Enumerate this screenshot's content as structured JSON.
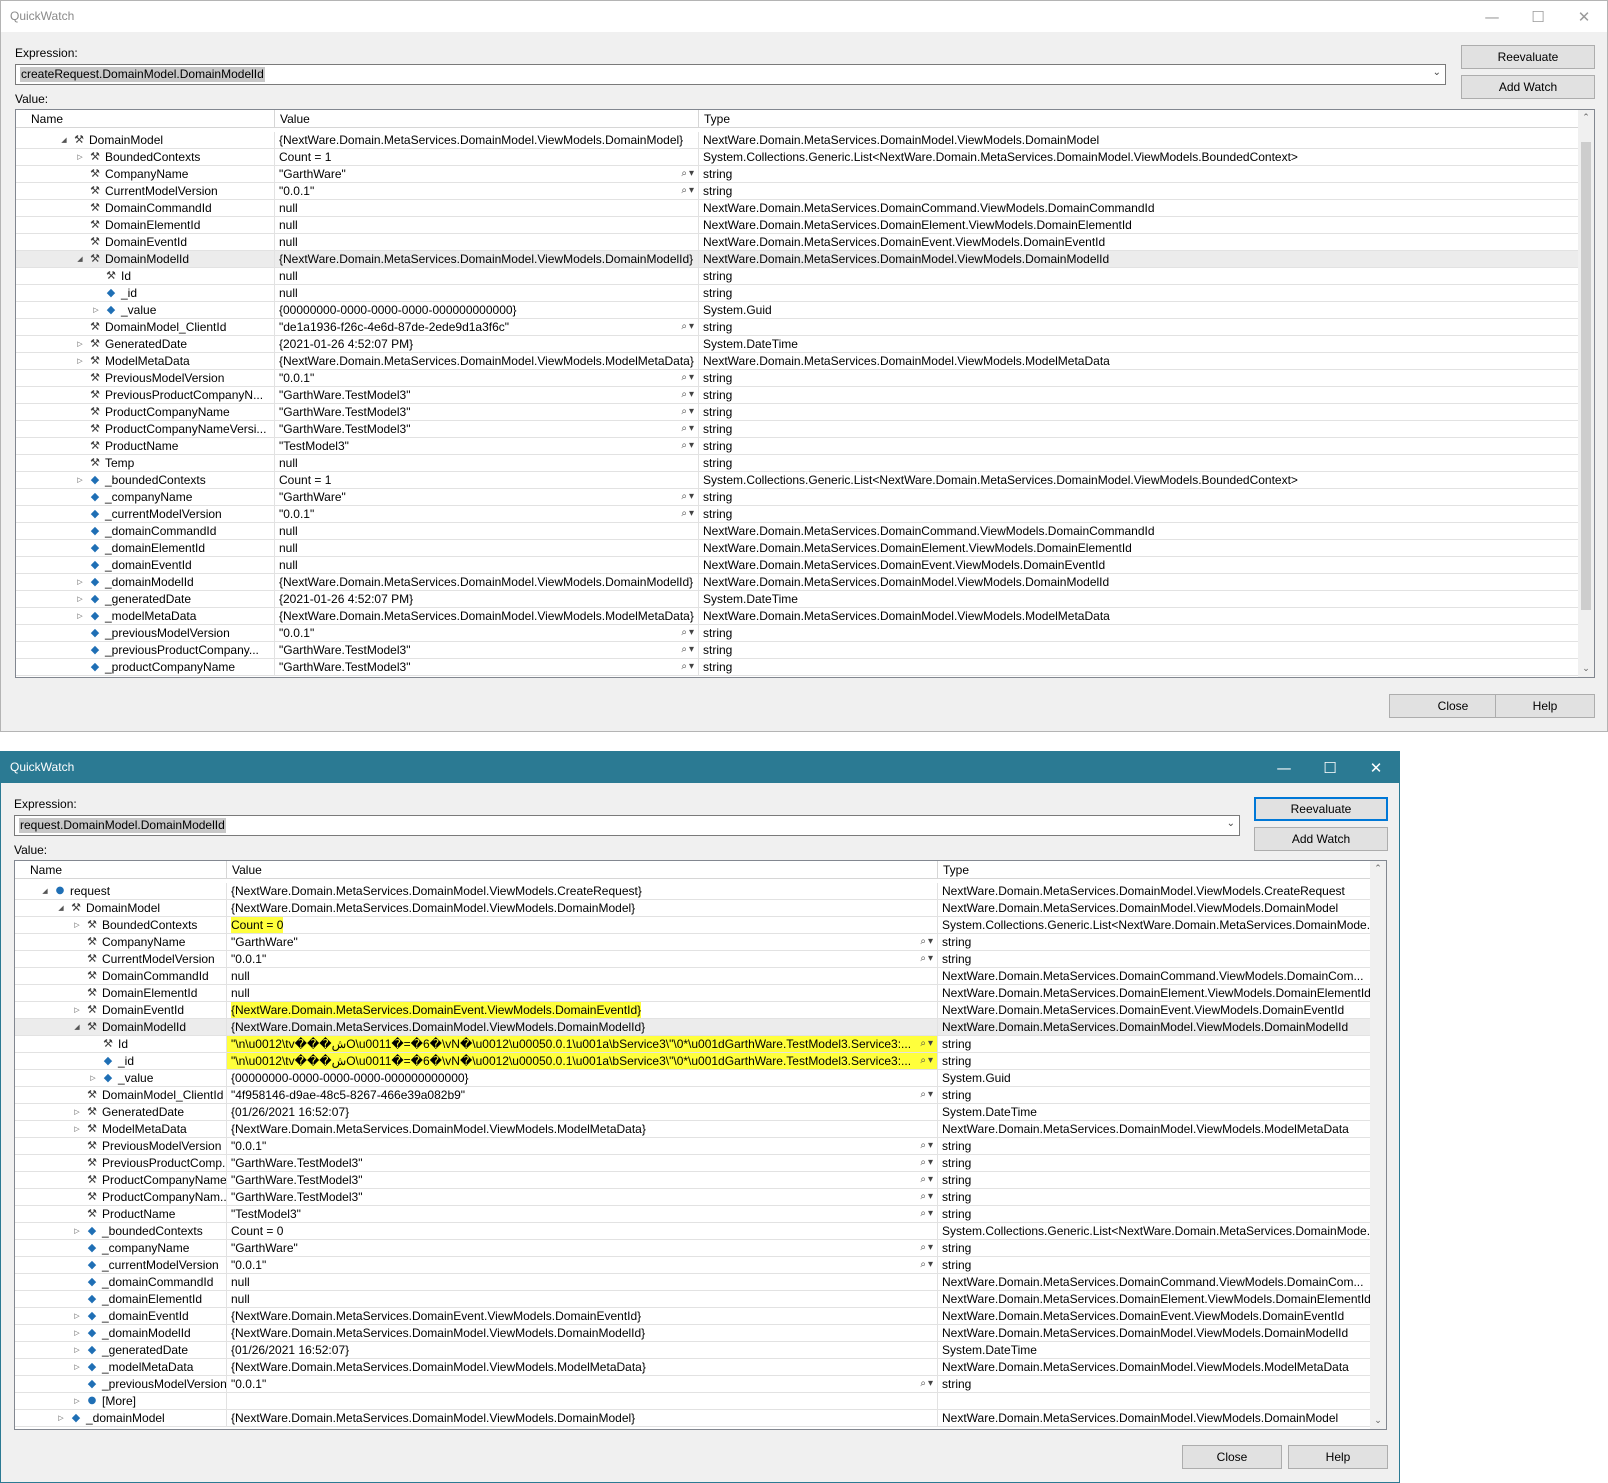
{
  "window1": {
    "title": "QuickWatch",
    "expression_label": "Expression:",
    "expression": "createRequest.DomainModel.DomainModelId",
    "value_label": "Value:",
    "buttons": {
      "reevaluate": "Reevaluate",
      "add_watch": "Add Watch",
      "close": "Close",
      "help": "Help"
    },
    "columns": [
      "Name",
      "Value",
      "Type"
    ],
    "rows": [
      {
        "depth": 1,
        "exp": "open",
        "icon": "prop",
        "name": "DomainModel",
        "value": "{NextWare.Domain.MetaServices.DomainModel.ViewModels.DomainModel}",
        "type": "NextWare.Domain.MetaServices.DomainModel.ViewModels.DomainModel"
      },
      {
        "depth": 2,
        "exp": "closed",
        "icon": "prop",
        "name": "BoundedContexts",
        "value": "Count = 1",
        "type": "System.Collections.Generic.List<NextWare.Domain.MetaServices.DomainModel.ViewModels.BoundedContext>"
      },
      {
        "depth": 2,
        "icon": "prop",
        "name": "CompanyName",
        "value": "\"GarthWare\"",
        "tools": true,
        "type": "string"
      },
      {
        "depth": 2,
        "icon": "prop",
        "name": "CurrentModelVersion",
        "value": "\"0.0.1\"",
        "tools": true,
        "type": "string"
      },
      {
        "depth": 2,
        "icon": "prop",
        "name": "DomainCommandId",
        "value": "null",
        "type": "NextWare.Domain.MetaServices.DomainCommand.ViewModels.DomainCommandId"
      },
      {
        "depth": 2,
        "icon": "prop",
        "name": "DomainElementId",
        "value": "null",
        "type": "NextWare.Domain.MetaServices.DomainElement.ViewModels.DomainElementId"
      },
      {
        "depth": 2,
        "icon": "prop",
        "name": "DomainEventId",
        "value": "null",
        "type": "NextWare.Domain.MetaServices.DomainEvent.ViewModels.DomainEventId"
      },
      {
        "depth": 2,
        "exp": "open",
        "icon": "prop",
        "name": "DomainModelId",
        "value": "{NextWare.Domain.MetaServices.DomainModel.ViewModels.DomainModelId}",
        "type": "NextWare.Domain.MetaServices.DomainModel.ViewModels.DomainModelId",
        "selected": true
      },
      {
        "depth": 3,
        "icon": "prop",
        "name": "Id",
        "value": "null",
        "type": "string"
      },
      {
        "depth": 3,
        "icon": "field",
        "name": "_id",
        "value": "null",
        "type": "string"
      },
      {
        "depth": 3,
        "exp": "closed",
        "icon": "field",
        "name": "_value",
        "value": "{00000000-0000-0000-0000-000000000000}",
        "type": "System.Guid"
      },
      {
        "depth": 2,
        "icon": "prop",
        "name": "DomainModel_ClientId",
        "value": "\"de1a1936-f26c-4e6d-87de-2ede9d1a3f6c\"",
        "tools": true,
        "type": "string"
      },
      {
        "depth": 2,
        "exp": "closed",
        "icon": "prop",
        "name": "GeneratedDate",
        "value": "{2021-01-26 4:52:07 PM}",
        "type": "System.DateTime"
      },
      {
        "depth": 2,
        "exp": "closed",
        "icon": "prop",
        "name": "ModelMetaData",
        "value": "{NextWare.Domain.MetaServices.DomainModel.ViewModels.ModelMetaData}",
        "type": "NextWare.Domain.MetaServices.DomainModel.ViewModels.ModelMetaData"
      },
      {
        "depth": 2,
        "icon": "prop",
        "name": "PreviousModelVersion",
        "value": "\"0.0.1\"",
        "tools": true,
        "type": "string"
      },
      {
        "depth": 2,
        "icon": "prop",
        "name": "PreviousProductCompanyN...",
        "value": "\"GarthWare.TestModel3\"",
        "tools": true,
        "type": "string"
      },
      {
        "depth": 2,
        "icon": "prop",
        "name": "ProductCompanyName",
        "value": "\"GarthWare.TestModel3\"",
        "tools": true,
        "type": "string"
      },
      {
        "depth": 2,
        "icon": "prop",
        "name": "ProductCompanyNameVersi...",
        "value": "\"GarthWare.TestModel3\"",
        "tools": true,
        "type": "string"
      },
      {
        "depth": 2,
        "icon": "prop",
        "name": "ProductName",
        "value": "\"TestModel3\"",
        "tools": true,
        "type": "string"
      },
      {
        "depth": 2,
        "icon": "prop",
        "name": "Temp",
        "value": "null",
        "type": "string"
      },
      {
        "depth": 2,
        "exp": "closed",
        "icon": "field",
        "name": "_boundedContexts",
        "value": "Count = 1",
        "type": "System.Collections.Generic.List<NextWare.Domain.MetaServices.DomainModel.ViewModels.BoundedContext>"
      },
      {
        "depth": 2,
        "icon": "field",
        "name": "_companyName",
        "value": "\"GarthWare\"",
        "tools": true,
        "type": "string"
      },
      {
        "depth": 2,
        "icon": "field",
        "name": "_currentModelVersion",
        "value": "\"0.0.1\"",
        "tools": true,
        "type": "string"
      },
      {
        "depth": 2,
        "icon": "field",
        "name": "_domainCommandId",
        "value": "null",
        "type": "NextWare.Domain.MetaServices.DomainCommand.ViewModels.DomainCommandId"
      },
      {
        "depth": 2,
        "icon": "field",
        "name": "_domainElementId",
        "value": "null",
        "type": "NextWare.Domain.MetaServices.DomainElement.ViewModels.DomainElementId"
      },
      {
        "depth": 2,
        "icon": "field",
        "name": "_domainEventId",
        "value": "null",
        "type": "NextWare.Domain.MetaServices.DomainEvent.ViewModels.DomainEventId"
      },
      {
        "depth": 2,
        "exp": "closed",
        "icon": "field",
        "name": "_domainModelId",
        "value": "{NextWare.Domain.MetaServices.DomainModel.ViewModels.DomainModelId}",
        "type": "NextWare.Domain.MetaServices.DomainModel.ViewModels.DomainModelId"
      },
      {
        "depth": 2,
        "exp": "closed",
        "icon": "field",
        "name": "_generatedDate",
        "value": "{2021-01-26 4:52:07 PM}",
        "type": "System.DateTime"
      },
      {
        "depth": 2,
        "exp": "closed",
        "icon": "field",
        "name": "_modelMetaData",
        "value": "{NextWare.Domain.MetaServices.DomainModel.ViewModels.ModelMetaData}",
        "type": "NextWare.Domain.MetaServices.DomainModel.ViewModels.ModelMetaData"
      },
      {
        "depth": 2,
        "icon": "field",
        "name": "_previousModelVersion",
        "value": "\"0.0.1\"",
        "tools": true,
        "type": "string"
      },
      {
        "depth": 2,
        "icon": "field",
        "name": "_previousProductCompany...",
        "value": "\"GarthWare.TestModel3\"",
        "tools": true,
        "type": "string"
      },
      {
        "depth": 2,
        "icon": "field",
        "name": "_productCompanyName",
        "value": "\"GarthWare.TestModel3\"",
        "tools": true,
        "type": "string"
      }
    ]
  },
  "window2": {
    "title": "QuickWatch",
    "expression_label": "Expression:",
    "expression": "request.DomainModel.DomainModelId",
    "value_label": "Value:",
    "buttons": {
      "reevaluate": "Reevaluate",
      "add_watch": "Add Watch",
      "close": "Close",
      "help": "Help"
    },
    "columns": [
      "Name",
      "Value",
      "Type"
    ],
    "rows": [
      {
        "depth": 0,
        "exp": "open",
        "icon": "obj",
        "name": "request",
        "value": "{NextWare.Domain.MetaServices.DomainModel.ViewModels.CreateRequest}",
        "type": "NextWare.Domain.MetaServices.DomainModel.ViewModels.CreateRequest"
      },
      {
        "depth": 1,
        "exp": "open",
        "icon": "prop",
        "name": "DomainModel",
        "value": "{NextWare.Domain.MetaServices.DomainModel.ViewModels.DomainModel}",
        "type": "NextWare.Domain.MetaServices.DomainModel.ViewModels.DomainModel"
      },
      {
        "depth": 2,
        "exp": "closed",
        "icon": "prop",
        "name": "BoundedContexts",
        "value": "Count = 0",
        "highlight": true,
        "type": "System.Collections.Generic.List<NextWare.Domain.MetaServices.DomainMode..."
      },
      {
        "depth": 2,
        "icon": "prop",
        "name": "CompanyName",
        "value": "\"GarthWare\"",
        "tools": true,
        "type": "string"
      },
      {
        "depth": 2,
        "icon": "prop",
        "name": "CurrentModelVersion",
        "value": "\"0.0.1\"",
        "tools": true,
        "type": "string"
      },
      {
        "depth": 2,
        "icon": "prop",
        "name": "DomainCommandId",
        "value": "null",
        "type": "NextWare.Domain.MetaServices.DomainCommand.ViewModels.DomainCom..."
      },
      {
        "depth": 2,
        "icon": "prop",
        "name": "DomainElementId",
        "value": "null",
        "type": "NextWare.Domain.MetaServices.DomainElement.ViewModels.DomainElementId"
      },
      {
        "depth": 2,
        "exp": "closed",
        "icon": "prop",
        "name": "DomainEventId",
        "value": "{NextWare.Domain.MetaServices.DomainEvent.ViewModels.DomainEventId}",
        "highlight": true,
        "type": "NextWare.Domain.MetaServices.DomainEvent.ViewModels.DomainEventId"
      },
      {
        "depth": 2,
        "exp": "open",
        "icon": "prop",
        "name": "DomainModelId",
        "value": "{NextWare.Domain.MetaServices.DomainModel.ViewModels.DomainModelId}",
        "type": "NextWare.Domain.MetaServices.DomainModel.ViewModels.DomainModelId",
        "selected": true
      },
      {
        "depth": 3,
        "icon": "prop",
        "name": "Id",
        "value": "\"\\n\\u0012\\tv���شO\\u0011�=�6�\\vN�\\u0012\\u00050.0.1\\u001a\\bService3\\\"\\0*\\u001dGarthWare.TestModel3.Service3:...",
        "highlight": true,
        "tools": true,
        "type": "string"
      },
      {
        "depth": 3,
        "icon": "field",
        "name": "_id",
        "value": "\"\\n\\u0012\\tv���شO\\u0011�=�6�\\vN�\\u0012\\u00050.0.1\\u001a\\bService3\\\"\\0*\\u001dGarthWare.TestModel3.Service3:...",
        "highlight": true,
        "tools": true,
        "type": "string"
      },
      {
        "depth": 3,
        "exp": "closed",
        "icon": "field",
        "name": "_value",
        "value": "{00000000-0000-0000-0000-000000000000}",
        "type": "System.Guid"
      },
      {
        "depth": 2,
        "icon": "prop",
        "name": "DomainModel_ClientId",
        "value": "\"4f958146-d9ae-48c5-8267-466e39a082b9\"",
        "tools": true,
        "type": "string"
      },
      {
        "depth": 2,
        "exp": "closed",
        "icon": "prop",
        "name": "GeneratedDate",
        "value": "{01/26/2021 16:52:07}",
        "type": "System.DateTime"
      },
      {
        "depth": 2,
        "exp": "closed",
        "icon": "prop",
        "name": "ModelMetaData",
        "value": "{NextWare.Domain.MetaServices.DomainModel.ViewModels.ModelMetaData}",
        "type": "NextWare.Domain.MetaServices.DomainModel.ViewModels.ModelMetaData"
      },
      {
        "depth": 2,
        "icon": "prop",
        "name": "PreviousModelVersion",
        "value": "\"0.0.1\"",
        "tools": true,
        "type": "string"
      },
      {
        "depth": 2,
        "icon": "prop",
        "name": "PreviousProductComp...",
        "value": "\"GarthWare.TestModel3\"",
        "tools": true,
        "type": "string"
      },
      {
        "depth": 2,
        "icon": "prop",
        "name": "ProductCompanyName",
        "value": "\"GarthWare.TestModel3\"",
        "tools": true,
        "type": "string"
      },
      {
        "depth": 2,
        "icon": "prop",
        "name": "ProductCompanyNam...",
        "value": "\"GarthWare.TestModel3\"",
        "tools": true,
        "type": "string"
      },
      {
        "depth": 2,
        "icon": "prop",
        "name": "ProductName",
        "value": "\"TestModel3\"",
        "tools": true,
        "type": "string"
      },
      {
        "depth": 2,
        "exp": "closed",
        "icon": "field",
        "name": "_boundedContexts",
        "value": "Count = 0",
        "type": "System.Collections.Generic.List<NextWare.Domain.MetaServices.DomainMode..."
      },
      {
        "depth": 2,
        "icon": "field",
        "name": "_companyName",
        "value": "\"GarthWare\"",
        "tools": true,
        "type": "string"
      },
      {
        "depth": 2,
        "icon": "field",
        "name": "_currentModelVersion",
        "value": "\"0.0.1\"",
        "tools": true,
        "type": "string"
      },
      {
        "depth": 2,
        "icon": "field",
        "name": "_domainCommandId",
        "value": "null",
        "type": "NextWare.Domain.MetaServices.DomainCommand.ViewModels.DomainCom..."
      },
      {
        "depth": 2,
        "icon": "field",
        "name": "_domainElementId",
        "value": "null",
        "type": "NextWare.Domain.MetaServices.DomainElement.ViewModels.DomainElementId"
      },
      {
        "depth": 2,
        "exp": "closed",
        "icon": "field",
        "name": "_domainEventId",
        "value": "{NextWare.Domain.MetaServices.DomainEvent.ViewModels.DomainEventId}",
        "type": "NextWare.Domain.MetaServices.DomainEvent.ViewModels.DomainEventId"
      },
      {
        "depth": 2,
        "exp": "closed",
        "icon": "field",
        "name": "_domainModelId",
        "value": "{NextWare.Domain.MetaServices.DomainModel.ViewModels.DomainModelId}",
        "type": "NextWare.Domain.MetaServices.DomainModel.ViewModels.DomainModelId"
      },
      {
        "depth": 2,
        "exp": "closed",
        "icon": "field",
        "name": "_generatedDate",
        "value": "{01/26/2021 16:52:07}",
        "type": "System.DateTime"
      },
      {
        "depth": 2,
        "exp": "closed",
        "icon": "field",
        "name": "_modelMetaData",
        "value": "{NextWare.Domain.MetaServices.DomainModel.ViewModels.ModelMetaData}",
        "type": "NextWare.Domain.MetaServices.DomainModel.ViewModels.ModelMetaData"
      },
      {
        "depth": 2,
        "icon": "field",
        "name": "_previousModelVersion",
        "value": "\"0.0.1\"",
        "tools": true,
        "type": "string"
      },
      {
        "depth": 2,
        "exp": "closed",
        "icon": "obj",
        "name": "[More]",
        "value": "",
        "type": ""
      },
      {
        "depth": 1,
        "exp": "closed",
        "icon": "field",
        "name": "_domainModel",
        "value": "{NextWare.Domain.MetaServices.DomainModel.ViewModels.DomainModel}",
        "type": "NextWare.Domain.MetaServices.DomainModel.ViewModels.DomainModel"
      }
    ]
  },
  "icons": {
    "property": "wrench-icon",
    "field": "private-field-icon",
    "object": "object-icon",
    "search": "magnifier-icon",
    "expand": "triangle-icon"
  },
  "colors": {
    "highlight": "#ffff3c",
    "active_titlebar": "#2b7a93",
    "selected_row": "#ececec"
  }
}
